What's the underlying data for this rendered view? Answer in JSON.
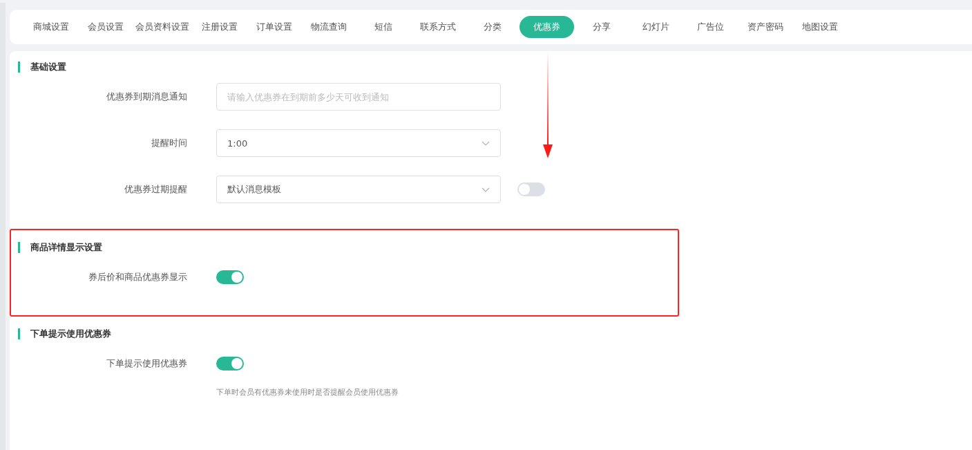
{
  "tabs": [
    {
      "label": "商城设置",
      "selected": false
    },
    {
      "label": "会员设置",
      "selected": false
    },
    {
      "label": "会员资料设置",
      "selected": false
    },
    {
      "label": "注册设置",
      "selected": false
    },
    {
      "label": "订单设置",
      "selected": false
    },
    {
      "label": "物流查询",
      "selected": false
    },
    {
      "label": "短信",
      "selected": false
    },
    {
      "label": "联系方式",
      "selected": false
    },
    {
      "label": "分类",
      "selected": false
    },
    {
      "label": "优惠券",
      "selected": true
    },
    {
      "label": "分享",
      "selected": false
    },
    {
      "label": "幻灯片",
      "selected": false
    },
    {
      "label": "广告位",
      "selected": false
    },
    {
      "label": "资产密码",
      "selected": false
    },
    {
      "label": "地图设置",
      "selected": false
    }
  ],
  "sections": [
    {
      "title": "基础设置",
      "highlighted": false,
      "rows": [
        {
          "kind": "input",
          "label": "优惠券到期消息通知",
          "placeholder": "请输入优惠券在到期前多少天可收到通知"
        },
        {
          "kind": "select",
          "label": "提醒时间",
          "value": "1:00"
        },
        {
          "kind": "select",
          "label": "优惠券过期提醒",
          "value": "默认消息模板",
          "switch_on": false
        }
      ]
    },
    {
      "title": "商品详情显示设置",
      "highlighted": true,
      "rows": [
        {
          "kind": "switch",
          "label": "券后价和商品优惠券显示",
          "on": true
        }
      ]
    },
    {
      "title": "下单提示使用优惠券",
      "highlighted": false,
      "rows": [
        {
          "kind": "switch",
          "label": "下单提示使用优惠券",
          "on": true,
          "hint": "下单时会员有优惠券未使用时是否提醒会员使用优惠券"
        }
      ]
    }
  ]
}
